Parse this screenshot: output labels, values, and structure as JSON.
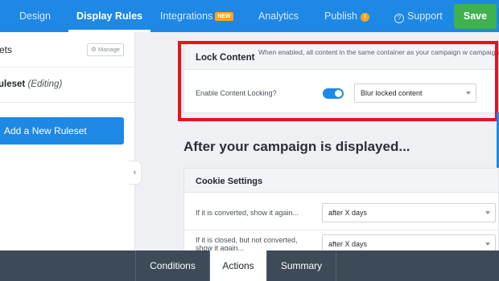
{
  "nav": {
    "items": [
      {
        "label": "Design"
      },
      {
        "label": "Display Rules"
      },
      {
        "label": "Integrations",
        "badge": "NEW"
      },
      {
        "label": "Analytics"
      },
      {
        "label": "Publish",
        "badge": "!"
      },
      {
        "label": "Support"
      }
    ],
    "save_label": "Save"
  },
  "sidebar": {
    "title": "ets",
    "manage_label": "Manage",
    "ruleset_name": "uleset",
    "ruleset_state": "(Editing)",
    "add_label": "Add a New Ruleset",
    "collapse_glyph": "‹"
  },
  "lock_content": {
    "title": "Lock Content",
    "description": "When enabled, all content in the same container as your campaign w campaign.",
    "enable_label": "Enable Content Locking?",
    "enabled": true,
    "mode_value": "Blur locked content"
  },
  "after_heading": "After your campaign is displayed...",
  "cookie_settings": {
    "title": "Cookie Settings",
    "rows": [
      {
        "label": "If it is converted, show it again...",
        "value": "after X days"
      },
      {
        "label": "If it is closed, but not converted, show it again...",
        "value": "after X days"
      }
    ]
  },
  "bottom_tabs": [
    {
      "label": "Conditions",
      "active": false
    },
    {
      "label": "Actions",
      "active": true
    },
    {
      "label": "Summary",
      "active": false
    }
  ],
  "colors": {
    "brand_blue": "#1e88e5",
    "save_green": "#3fb24f",
    "highlight_red": "#e8121b",
    "badge_orange": "#f6a623",
    "bottom_bar": "#3d4a57"
  }
}
